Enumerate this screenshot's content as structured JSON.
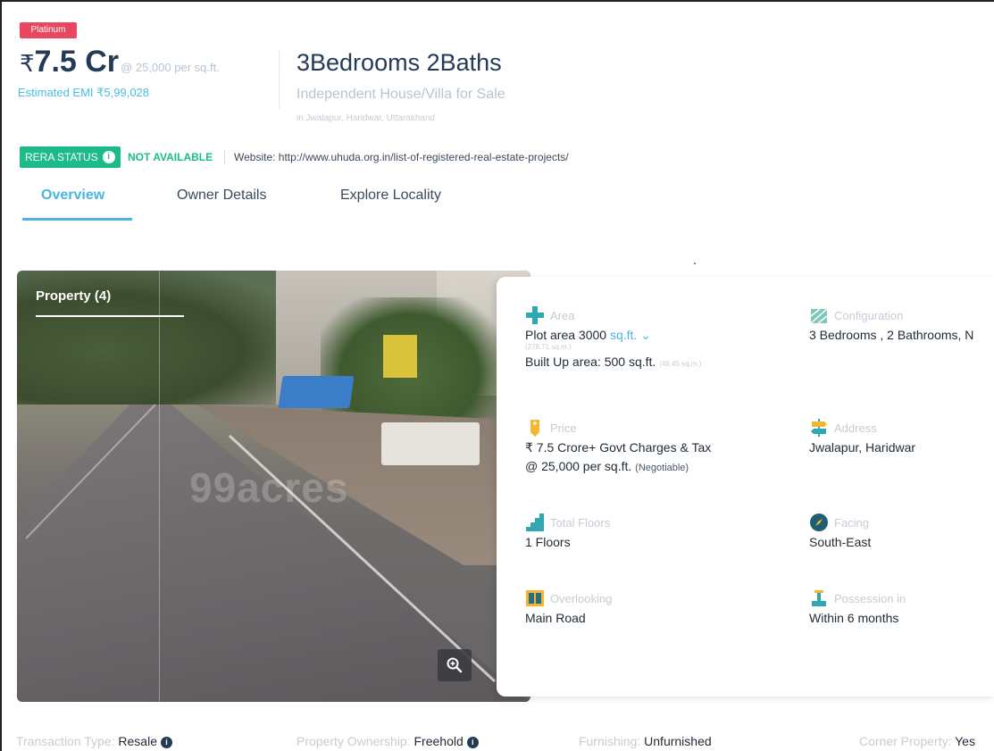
{
  "badge": "Platinum",
  "price": {
    "symbol": "₹",
    "amount": "7.5 Cr",
    "rate": "@ 25,000 per sq.ft.",
    "emi": "Estimated EMI ₹5,99,028"
  },
  "listing": {
    "title": "3Bedrooms 2Baths",
    "subtitle": "Independent House/Villa for Sale",
    "locality": "in Jwalapur, Haridwar, Uttarakhand"
  },
  "rera": {
    "badge": "RERA STATUS",
    "status": "NOT AVAILABLE",
    "website": "Website: http://www.uhuda.org.in/list-of-registered-real-estate-projects/"
  },
  "tabs": [
    {
      "label": "Overview",
      "active": true
    },
    {
      "label": "Owner Details",
      "active": false
    },
    {
      "label": "Explore Locality",
      "active": false
    }
  ],
  "photo": {
    "label": "Property (4)",
    "watermark": "99acres"
  },
  "features": {
    "area": {
      "label": "Area",
      "plot_prefix": "Plot area 3000",
      "plot_unit": "sq.ft.",
      "plot_sqm": "(278.71 sq.m.)",
      "builtup": "Built Up area: 500 sq.ft.",
      "builtup_sqm": "(46.45 sq.m.)"
    },
    "configuration": {
      "label": "Configuration",
      "value": "3 Bedrooms , 2 Bathrooms, N"
    },
    "price": {
      "label": "Price",
      "line1": "₹ 7.5 Crore+ Govt Charges & Tax",
      "line2": "@ 25,000 per sq.ft.",
      "negotiable": "(Negotiable)"
    },
    "address": {
      "label": "Address",
      "value": "Jwalapur, Haridwar"
    },
    "floors": {
      "label": "Total Floors",
      "value": "1 Floors"
    },
    "facing": {
      "label": "Facing",
      "value": "South-East"
    },
    "overlooking": {
      "label": "Overlooking",
      "value": "Main Road"
    },
    "possession": {
      "label": "Possession in",
      "value": "Within 6 months"
    }
  },
  "details": [
    {
      "label": "Transaction Type:",
      "value": "Resale",
      "info": true
    },
    {
      "label": "Property Ownership:",
      "value": "Freehold",
      "info": true
    },
    {
      "label": "Furnishing:",
      "value": "Unfurnished",
      "info": false
    },
    {
      "label": "Corner Property:",
      "value": "Yes",
      "info": false
    }
  ],
  "colors": {
    "accent": "#48b6e0",
    "rera_green": "#1dba8a",
    "badge_red": "#e8475f",
    "title_navy": "#243a56"
  }
}
